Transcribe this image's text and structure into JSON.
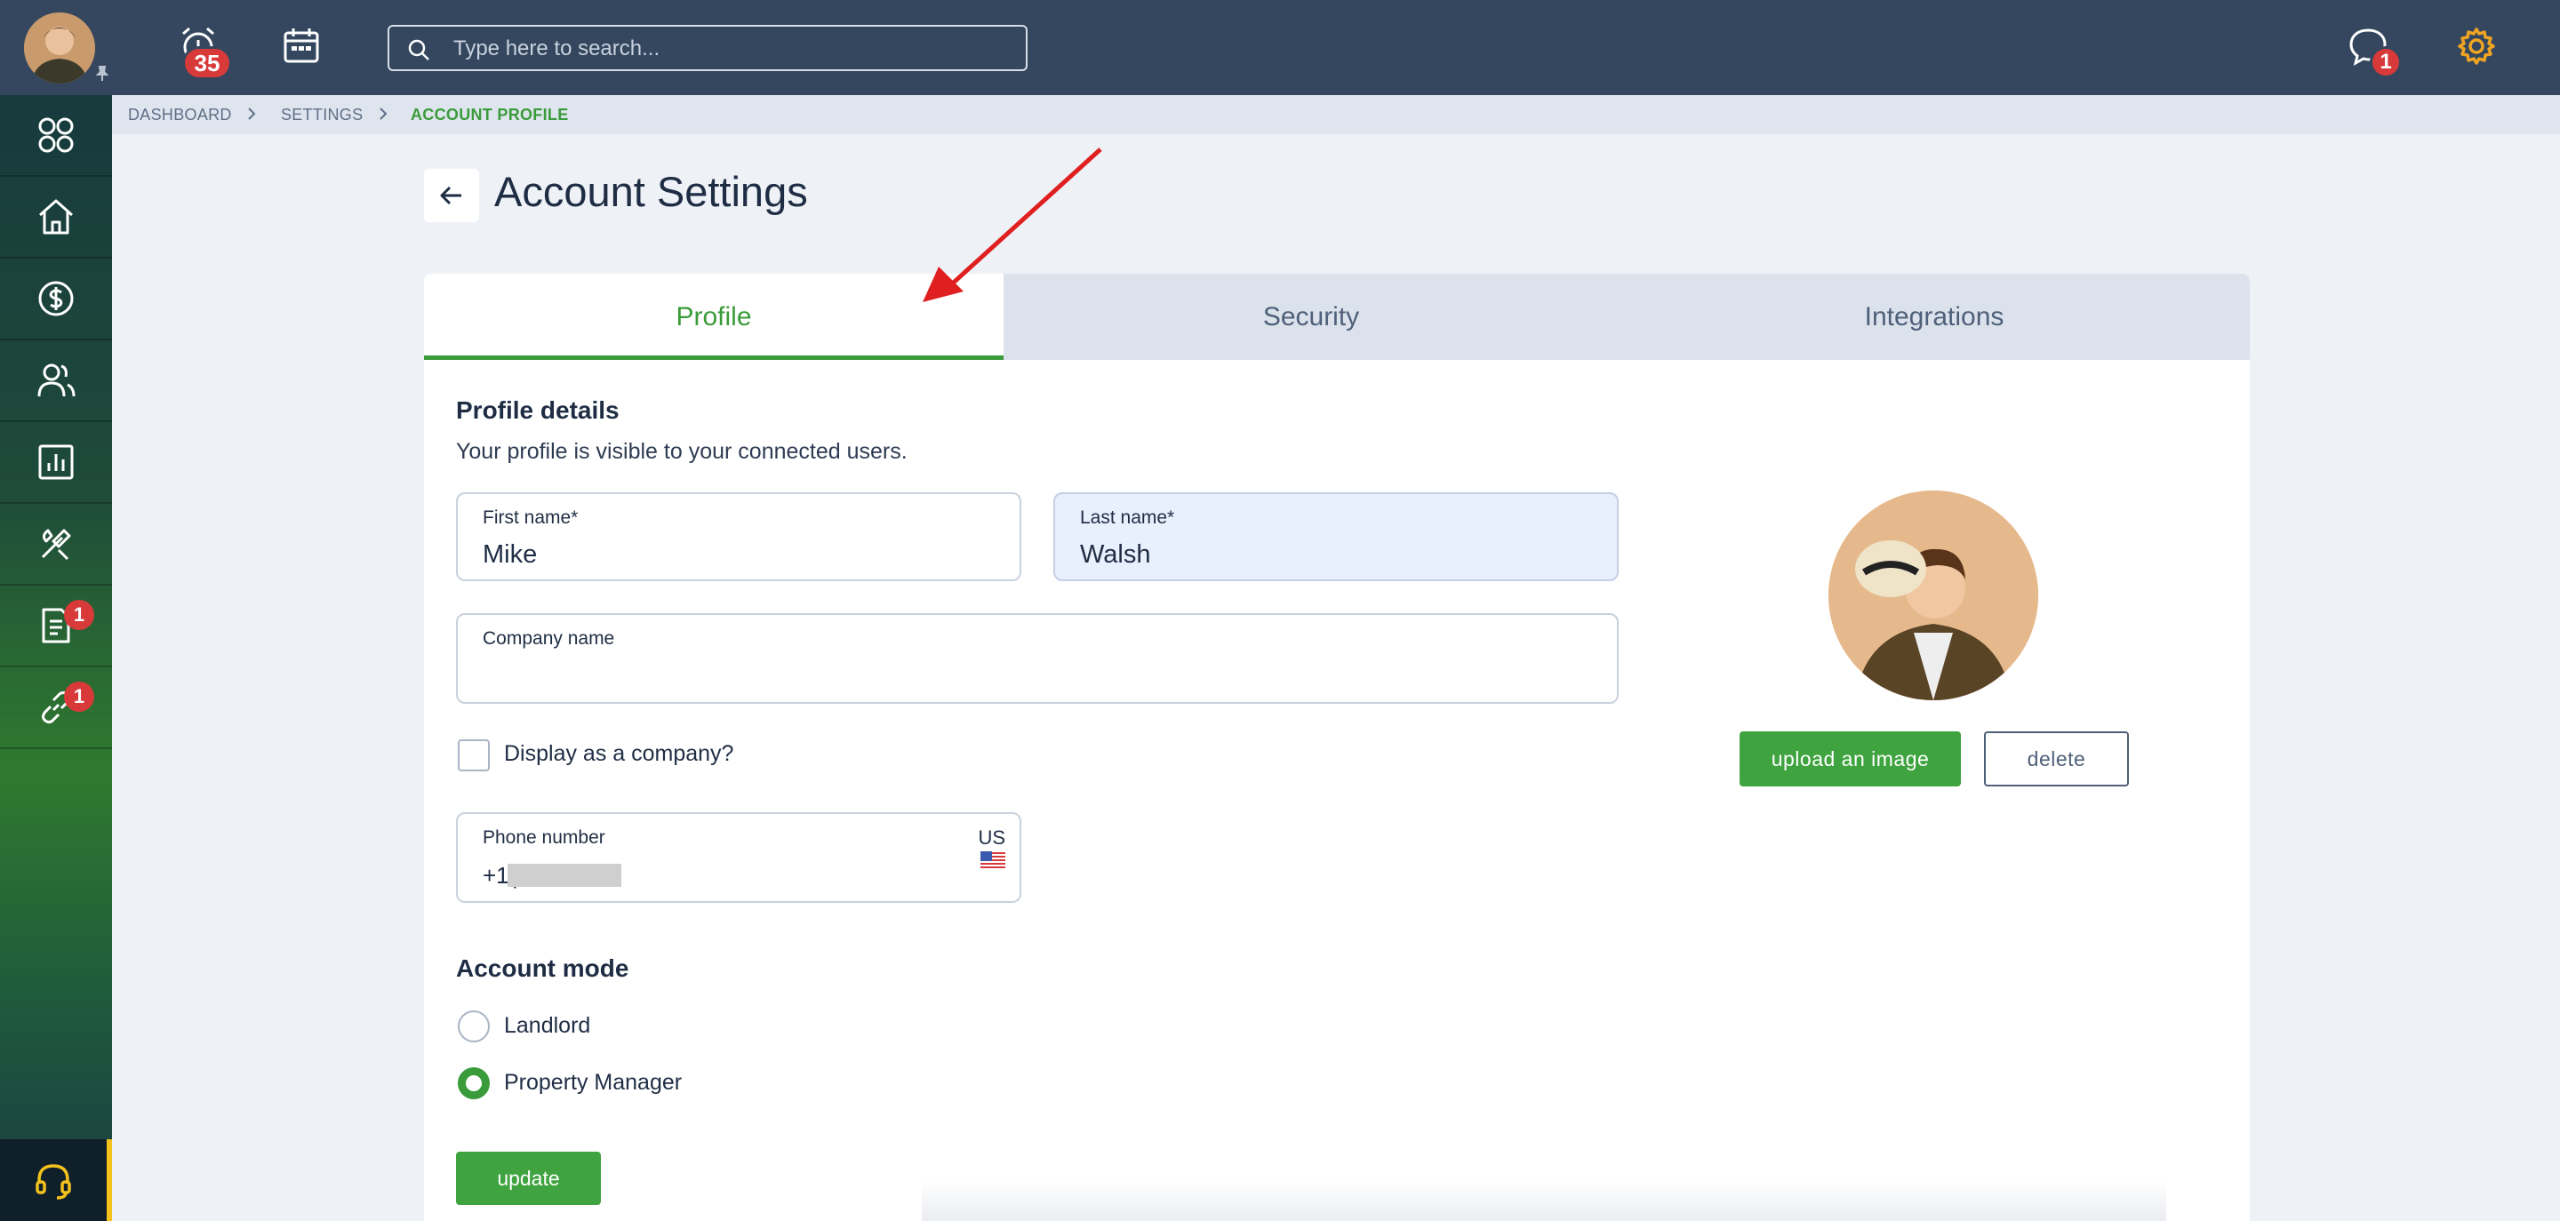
{
  "topbar": {
    "search_placeholder": "Type here to search...",
    "alarm_badge": "35",
    "chat_badge": "1",
    "accent_color": "#f0a422"
  },
  "sidebar": {
    "items": [
      {
        "icon": "apps-grid-icon"
      },
      {
        "icon": "home-icon"
      },
      {
        "icon": "dollar-icon"
      },
      {
        "icon": "users-icon"
      },
      {
        "icon": "chart-icon"
      },
      {
        "icon": "tools-icon"
      },
      {
        "icon": "document-icon",
        "badge": "1"
      },
      {
        "icon": "link-icon",
        "badge": "1"
      }
    ],
    "support_icon": "headset-icon"
  },
  "breadcrumb": {
    "items": [
      "DASHBOARD",
      "SETTINGS",
      "ACCOUNT PROFILE"
    ]
  },
  "header": {
    "title": "Account Settings"
  },
  "tabs": [
    "Profile",
    "Security",
    "Integrations"
  ],
  "profile": {
    "section_title": "Profile details",
    "section_subtitle": "Your profile is visible to your connected users.",
    "first_name_label": "First name*",
    "first_name_value": "Mike",
    "last_name_label": "Last name*",
    "last_name_value": "Walsh",
    "company_label": "Company name",
    "company_value": "",
    "display_company_label": "Display as a company?",
    "phone_label": "Phone number",
    "phone_prefix": "+1(",
    "phone_country": "US",
    "upload_label": "upload an image",
    "delete_label": "delete"
  },
  "account_mode": {
    "title": "Account mode",
    "options": [
      "Landlord",
      "Property Manager"
    ],
    "selected": "Property Manager"
  },
  "update_label": "update",
  "colors": {
    "primary_green": "#3fa33f",
    "topbar": "#34475f",
    "badge_red": "#d83a3a"
  }
}
